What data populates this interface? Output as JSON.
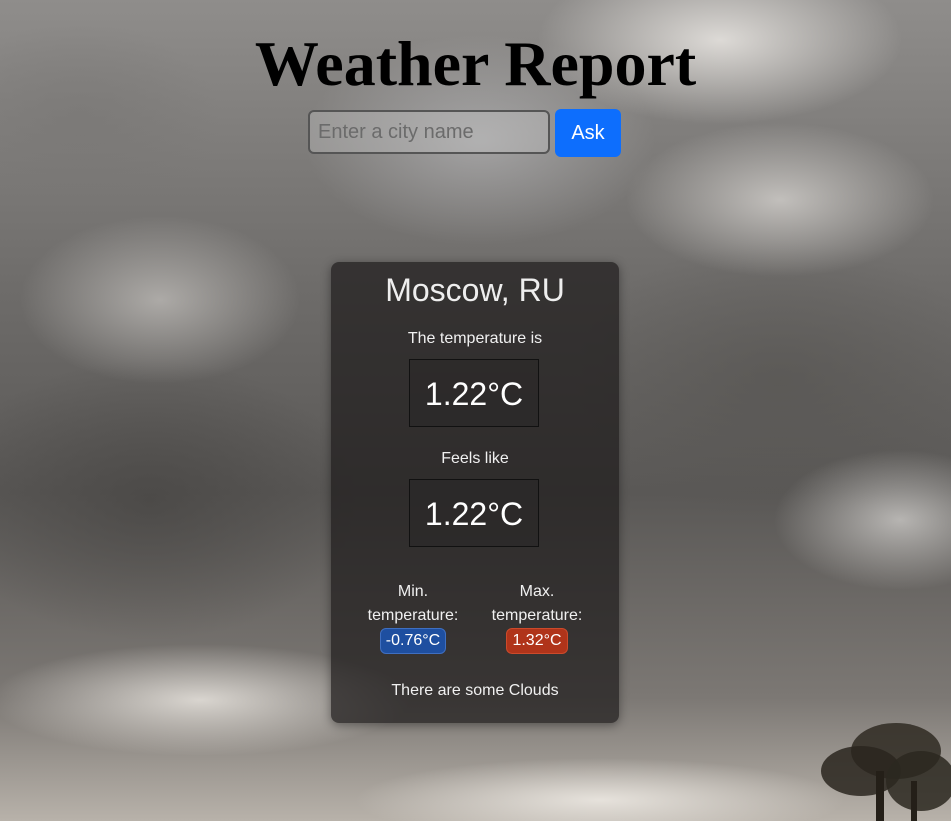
{
  "header": {
    "title": "Weather Report"
  },
  "search": {
    "placeholder": "Enter a city name",
    "value": "",
    "button_label": "Ask",
    "button_color": "#0d6efd"
  },
  "weather": {
    "city": "Moscow, RU",
    "temperature_label": "The temperature is",
    "temperature": "1.22°C",
    "feels_like_label": "Feels like",
    "feels_like": "1.22°C",
    "min_label": "Min. temperature:",
    "min_value": "-0.76°C",
    "min_color": "#1e4fa0",
    "max_label": "Max. temperature:",
    "max_value": "1.32°C",
    "max_color": "#b0341a",
    "description": "There are some Clouds"
  },
  "background": {
    "scene": "cloudy-sky-image"
  }
}
